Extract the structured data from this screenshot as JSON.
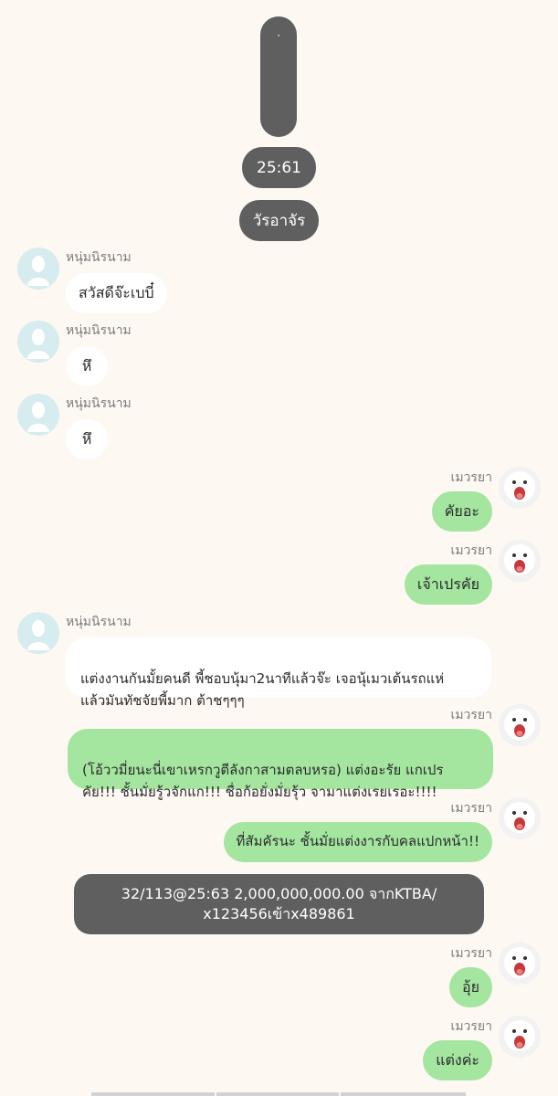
{
  "system": {
    "top_bar_text": "·",
    "time_label": "25:61",
    "date_label": "วัรอาจัร"
  },
  "contacts": {
    "other": "หนุ่มนิรนาม",
    "me": "เมวรยา"
  },
  "messages": [
    {
      "sender": "other",
      "text": "สวัสดีจ๊ะเบบี๋"
    },
    {
      "sender": "other",
      "text": "หึ"
    },
    {
      "sender": "other",
      "text": "หึ"
    },
    {
      "sender": "me",
      "text": "คัยอะ"
    },
    {
      "sender": "me",
      "text": "เจ้าเปรคัย"
    },
    {
      "sender": "other",
      "text": "แต่งงานกันมั้ยคนดี พี้ชอบนุ้มา2นาทีแล้วจ๊ะ เจอนุ้เมวเต้นรถแห่\nแล้วมันทัชจัยพี้มาก ต้าชๆๆๆ"
    },
    {
      "sender": "me",
      "text": "(โอ้ววมี่ยนะนี่เขาเหรกวูตีลังกาสามตลบหรอ) แต่งอะรัย แกเปร\nคัย!!! ชั้นมั่ยรู้วจักแก!!! ชื่อก้อยั่งมั่ยรุ้ว จามาแต่งเรยเรอะ!!!!"
    },
    {
      "sender": "me",
      "text": "ที่สัมคัรนะ ชั้นมั่ยแต่งงารกับคลแปกหน้า!!"
    },
    {
      "sender": "me",
      "text": "อุ้ย"
    },
    {
      "sender": "me",
      "text": "แต่งค่ะ"
    }
  ],
  "transfer": {
    "text": "32/113@25:63 2,000,000,000.00 จากKTBA/\nx123456เข้าx489861"
  },
  "colors": {
    "background": "#fdf8f2",
    "outgoing_bubble": "#a4e5a0",
    "incoming_bubble": "#ffffff",
    "system_pill": "#5f5f5f"
  }
}
